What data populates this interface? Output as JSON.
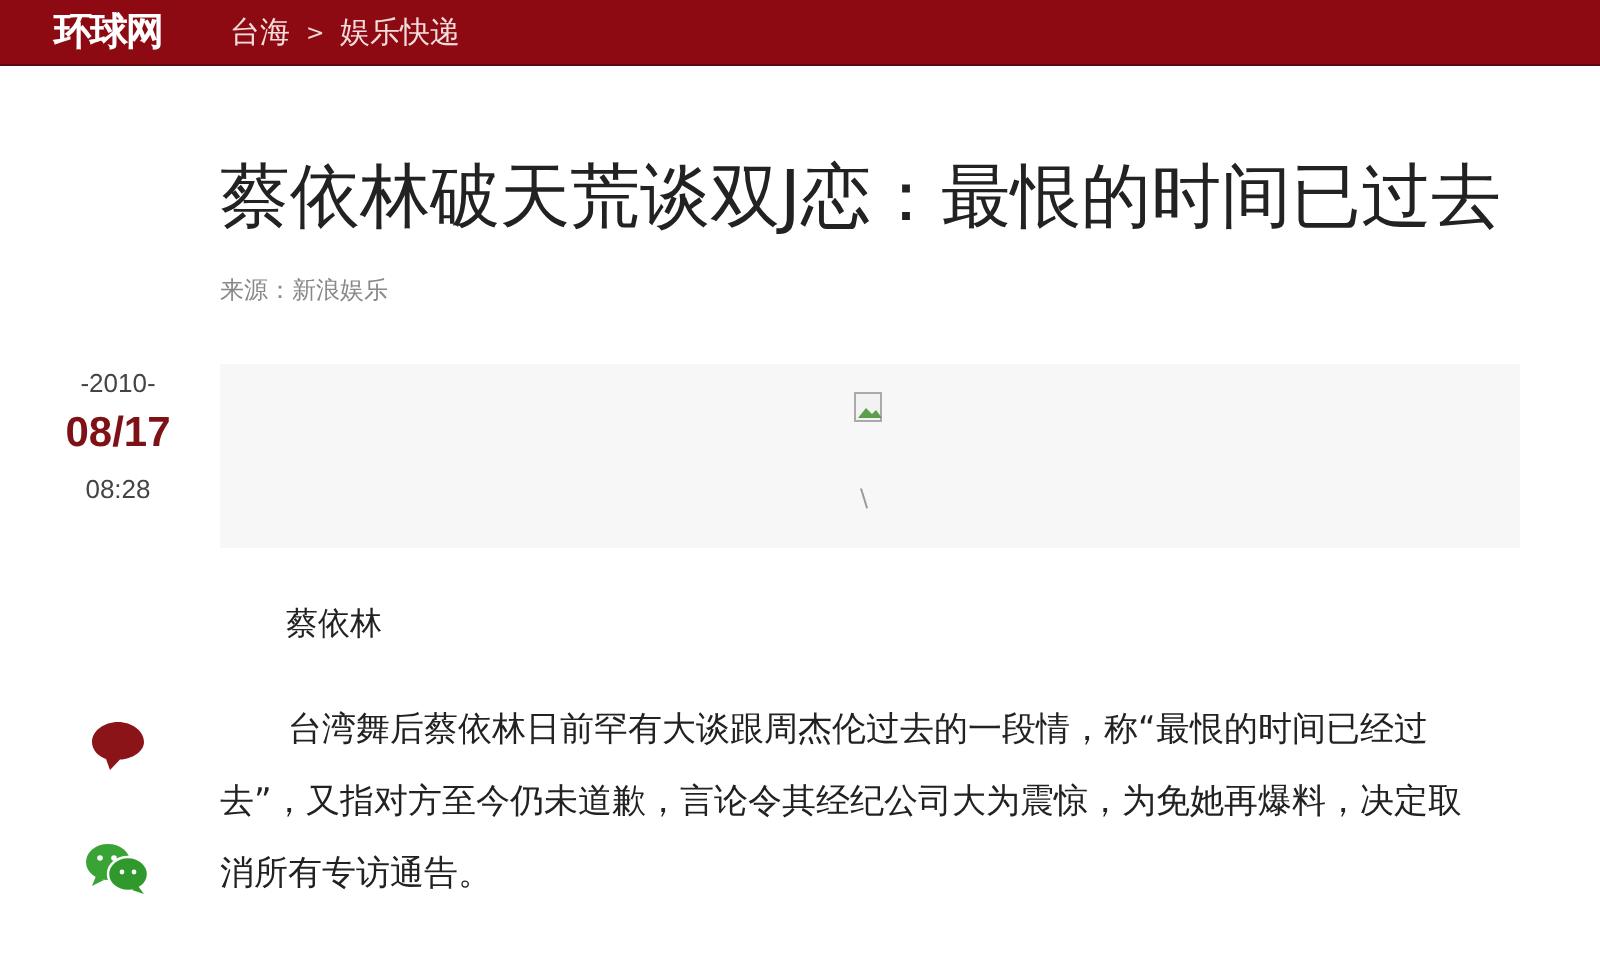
{
  "header": {
    "logo": "环球网",
    "breadcrumb": [
      {
        "label": "台海"
      },
      {
        "label": ">",
        "kind": "separator"
      },
      {
        "label": "娱乐快递"
      }
    ]
  },
  "article": {
    "title": "蔡依林破天荒谈双J恋：最恨的时间已过去",
    "source": "来源：新浪娱乐",
    "date": {
      "year": "-2010-",
      "day": "08/17",
      "time": "08:28"
    },
    "image": {
      "kind": "broken",
      "caption_mark": "\\"
    },
    "caption": "蔡依林",
    "paragraph": "台湾舞后蔡依林日前罕有大谈跟周杰伦过去的一段情，称“最恨的时间已经过去”，又指对方至今仍未道歉，言论令其经纪公司大为震惊，为免她再爆料，决定取消所有专访通告。"
  }
}
